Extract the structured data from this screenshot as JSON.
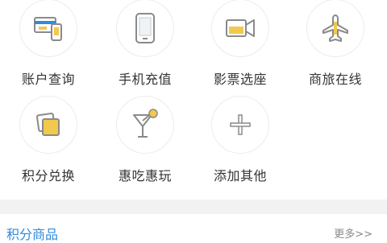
{
  "grid": {
    "items": [
      {
        "label": "账户查询",
        "icon": "account-query-icon"
      },
      {
        "label": "手机充值",
        "icon": "phone-recharge-icon"
      },
      {
        "label": "影票选座",
        "icon": "movie-ticket-icon"
      },
      {
        "label": "商旅在线",
        "icon": "airplane-icon"
      },
      {
        "label": "积分兑换",
        "icon": "points-exchange-icon"
      },
      {
        "label": "惠吃惠玩",
        "icon": "cocktail-icon"
      },
      {
        "label": "添加其他",
        "icon": "plus-icon"
      }
    ]
  },
  "section": {
    "title": "积分商品",
    "more": "更多>>"
  },
  "colors": {
    "accent": "#2f8bdc",
    "icon_yellow": "#f2c94c",
    "icon_stroke": "#8a8a8a"
  }
}
